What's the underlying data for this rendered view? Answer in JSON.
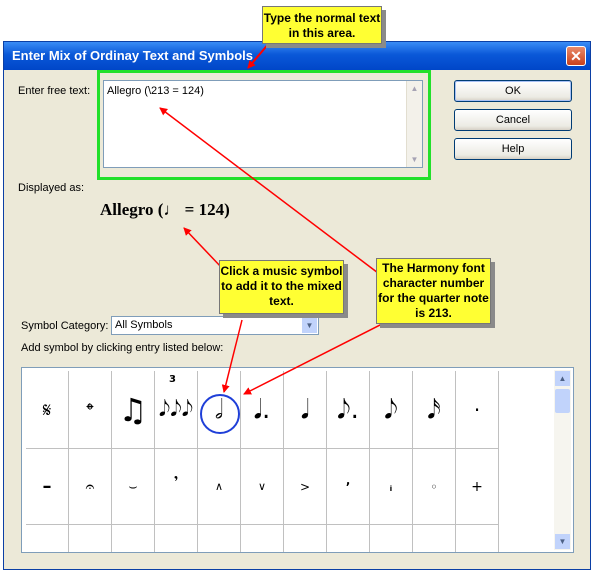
{
  "dialog": {
    "title": "Enter Mix of Ordinay Text and Symbols",
    "free_text_label": "Enter free text:",
    "free_text_value": "Allegro (\\213 = 124)",
    "displayed_label": "Displayed as:",
    "displayed_value": "Allegro (♩ = 124)",
    "category_label": "Symbol Category:",
    "category_value": "All Symbols",
    "add_symbol_label": "Add symbol by clicking entry listed below:",
    "buttons": {
      "ok": "OK",
      "cancel": "Cancel",
      "help": "Help"
    },
    "close_glyph": "✕"
  },
  "callouts": {
    "normal_text": "Type the normal text in this area.",
    "click_symbol": "Click a music symbol to add it to the mixed text.",
    "harmony": "The Harmony font character number for the quarter note is 213."
  },
  "symbols": {
    "row1": [
      "𝄋",
      "𝄌",
      "♫",
      "𝅘𝅥𝅮𝅘𝅥𝅮𝅘𝅥𝅮",
      "𝅗𝅥",
      "𝅘𝅥.",
      "𝅘𝅥",
      "𝅘𝅥𝅮.",
      "𝅘𝅥𝅮",
      "𝅘𝅥𝅯",
      "·"
    ],
    "triplet_label": "3",
    "row2": [
      "–",
      "𝄐",
      "⌣",
      "𝄒",
      "∧",
      "∨",
      ">",
      "ʼ",
      "ᵢ",
      "◦",
      "+"
    ]
  },
  "colors": {
    "highlight_green": "#22e02a",
    "callout_yellow": "#ffff33",
    "arrow_red": "#ff0000",
    "circle_blue": "#1f3fd8"
  }
}
